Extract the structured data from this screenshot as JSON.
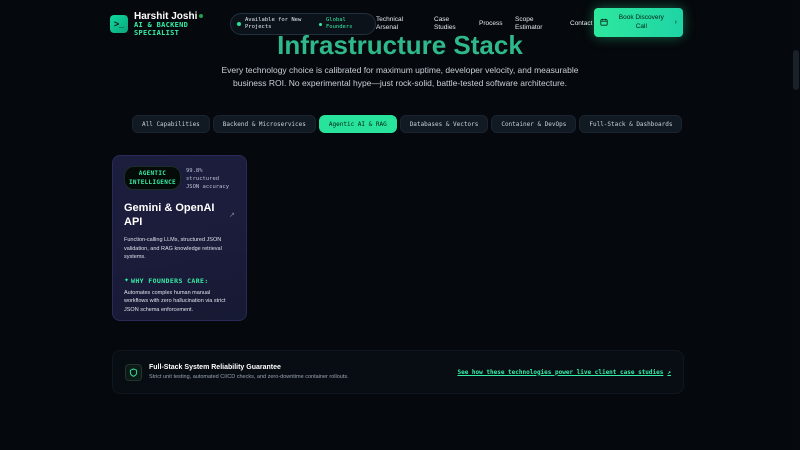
{
  "nav": {
    "brand_name": "Harshit Joshi",
    "brand_role_line1": "AI & BACKEND",
    "brand_role_line2": "SPECIALIST",
    "availability_line1": "Available for New",
    "availability_line2": "Projects",
    "availability_target_line1": "Global",
    "availability_target_line2": "Founders",
    "links": [
      {
        "line1": "Technical",
        "line2": "Arsenal"
      },
      {
        "line1": "Case",
        "line2": "Studies"
      },
      {
        "line1": "Process",
        "line2": ""
      },
      {
        "line1": "Scope",
        "line2": "Estimator"
      },
      {
        "line1": "Contact",
        "line2": ""
      }
    ],
    "cta_line1": "Book Discovery",
    "cta_line2": "Call",
    "cta_icon": "calendar-icon",
    "cta_arrow_icon": "arrow-right-icon"
  },
  "hero": {
    "title": "Infrastructure Stack",
    "subtitle_line1": "Every technology choice is calibrated for maximum uptime, developer velocity, and measurable",
    "subtitle_line2": "business ROI. No experimental hype—just rock-solid, battle-tested software architecture."
  },
  "tabs": [
    {
      "label": "All Capabilities",
      "active": false
    },
    {
      "label": "Backend & Microservices",
      "active": false
    },
    {
      "label": "Agentic AI & RAG",
      "active": true
    },
    {
      "label": "Databases & Vectors",
      "active": false
    },
    {
      "label": "Container & DevOps",
      "active": false
    },
    {
      "label": "Full-Stack & Dashboards",
      "active": false
    }
  ],
  "card": {
    "badge_line1": "AGENTIC",
    "badge_line2": "INTELLIGENCE",
    "accuracy_line1": "99.8% structured",
    "accuracy_line2": "JSON accuracy",
    "title": "Gemini & OpenAI API",
    "description": "Function-calling LLMs, structured JSON validation, and RAG knowledge retrieval systems.",
    "why_title": "WHY FOUNDERS CARE:",
    "why_description": "Automates complex human manual workflows with zero hallucination via strict JSON schema enforcement."
  },
  "banner": {
    "title": "Full-Stack System Reliability Guarantee",
    "description": "Strict unit testing, automated CI/CD checks, and zero-downtime container rollouts.",
    "link": "See how these technologies power live client case studies"
  },
  "colors": {
    "accent": "#27e39c",
    "background": "#05080c",
    "card_bg": "#1d1d3e"
  }
}
